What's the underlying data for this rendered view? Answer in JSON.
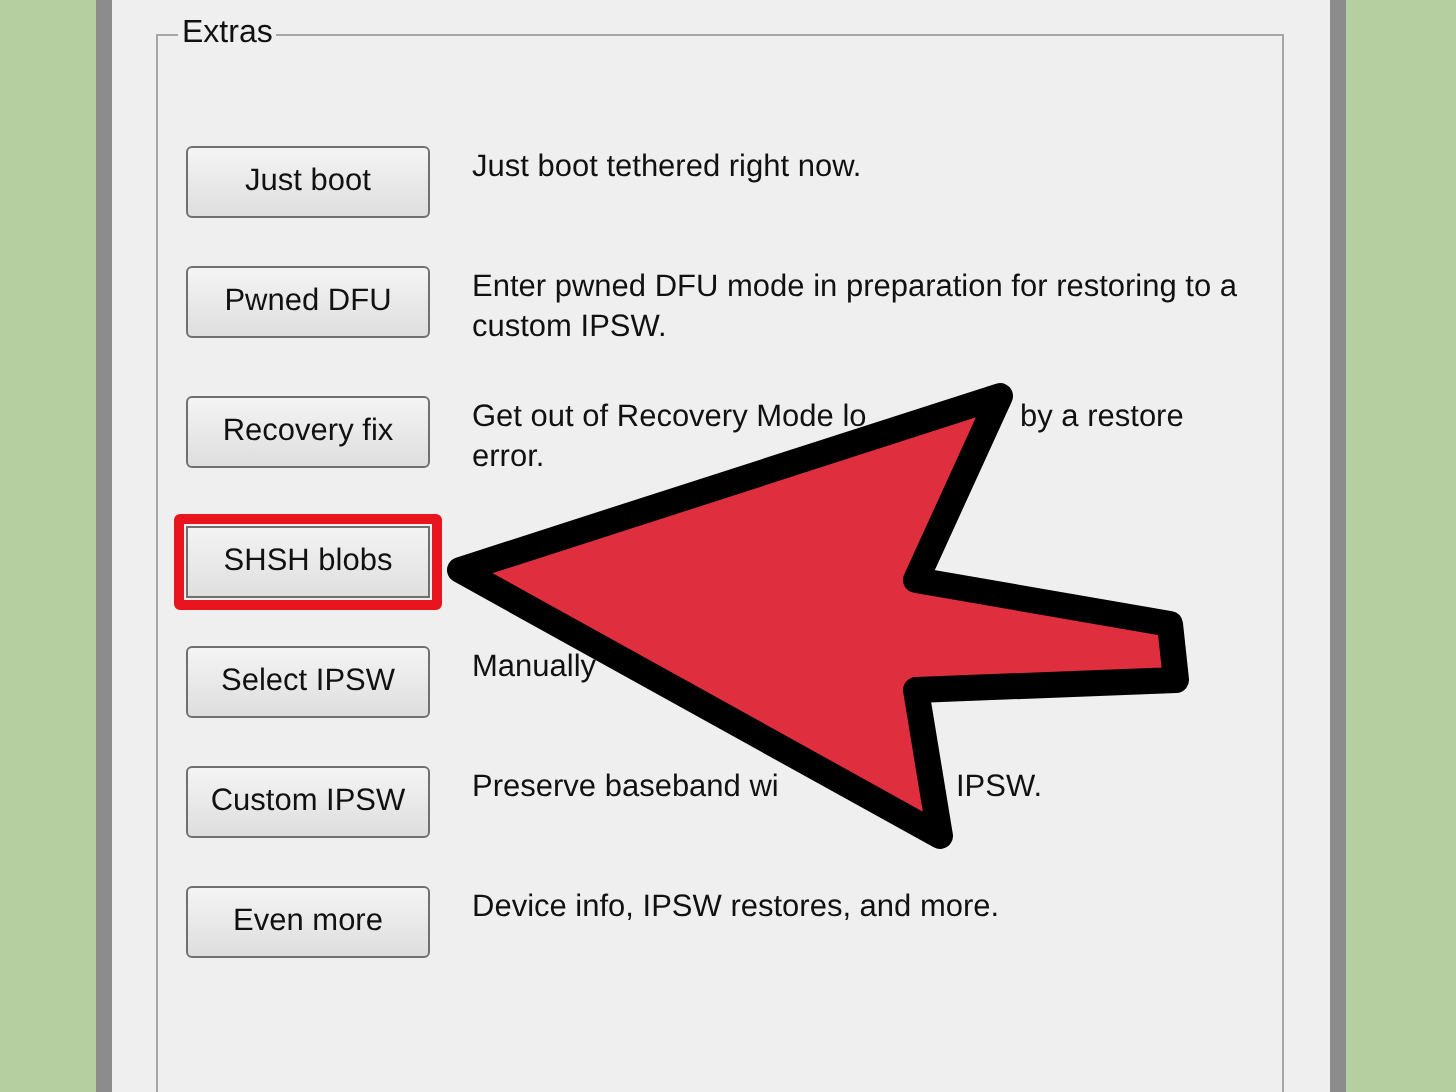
{
  "group": {
    "title": "Extras"
  },
  "rows": [
    {
      "button": "Just boot",
      "highlighted": false,
      "lines": [
        [
          "Just boot tethered right now."
        ]
      ]
    },
    {
      "button": "Pwned DFU",
      "highlighted": false,
      "lines": [
        [
          "Enter pwned DFU mode in preparation for restoring to a"
        ],
        [
          "custom IPSW."
        ]
      ]
    },
    {
      "button": "Recovery fix",
      "highlighted": false,
      "lines": [
        [
          "Get out of Recovery Mode lo",
          "by a restore"
        ],
        [
          "error."
        ]
      ]
    },
    {
      "button": "SHSH blobs",
      "highlighted": true
    },
    {
      "button": "Select IPSW",
      "highlighted": false,
      "lines": [
        [
          "Manually"
        ]
      ]
    },
    {
      "button": "Custom IPSW",
      "highlighted": false,
      "lines": [
        [
          "Preserve baseband wi",
          "IPSW."
        ]
      ]
    },
    {
      "button": "Even more",
      "highlighted": false,
      "lines": [
        [
          "Device info, IPSW restores, and more."
        ]
      ]
    }
  ]
}
